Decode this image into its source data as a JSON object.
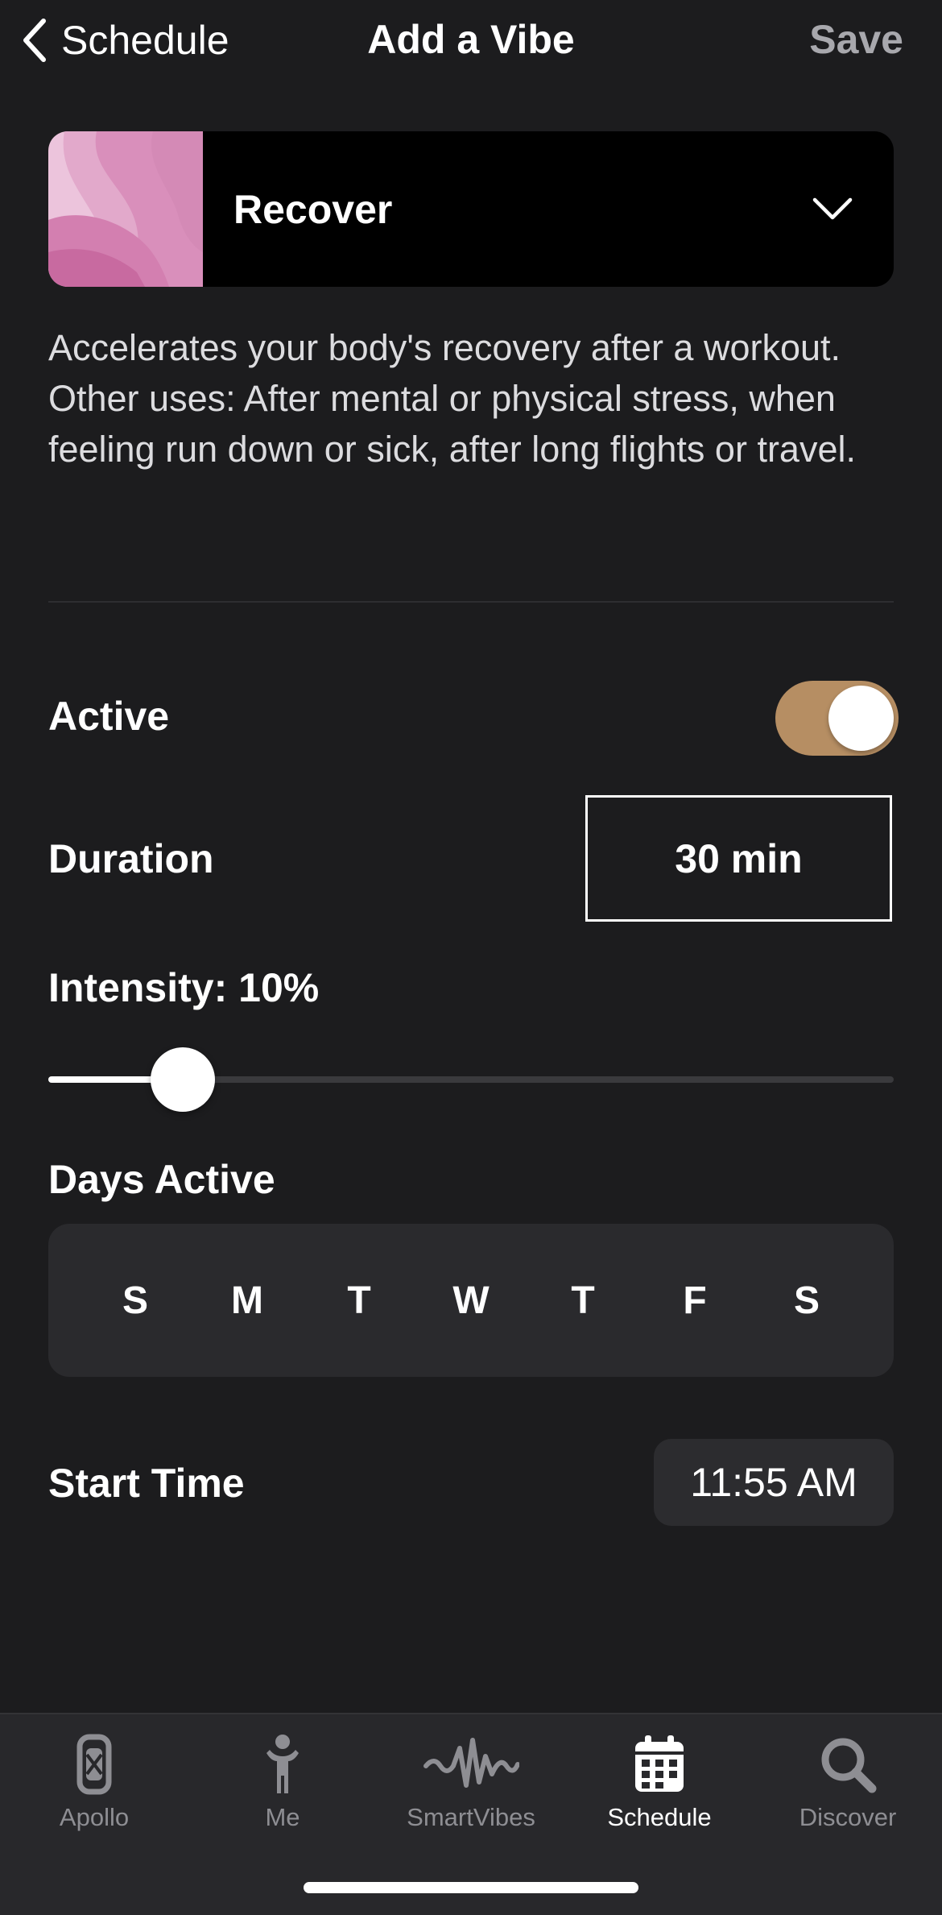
{
  "nav": {
    "back_label": "Schedule",
    "title": "Add a Vibe",
    "save_label": "Save"
  },
  "vibe": {
    "name": "Recover",
    "description": "Accelerates your body's recovery after a workout. Other uses: After mental or physical stress, when feeling run down or sick, after long flights or travel."
  },
  "settings": {
    "active_label": "Active",
    "active_on": true,
    "duration_label": "Duration",
    "duration_value": "30 min",
    "intensity_label": "Intensity: 10%",
    "intensity_value": 0.1,
    "days_label": "Days Active",
    "days": [
      "S",
      "M",
      "T",
      "W",
      "T",
      "F",
      "S"
    ],
    "start_time_label": "Start Time",
    "start_time_value": "11:55 AM"
  },
  "tabs": [
    {
      "label": "Apollo",
      "icon": "apollo-device-icon",
      "active": false
    },
    {
      "label": "Me",
      "icon": "person-icon",
      "active": false
    },
    {
      "label": "SmartVibes",
      "icon": "waveform-icon",
      "active": false
    },
    {
      "label": "Schedule",
      "icon": "calendar-icon",
      "active": true
    },
    {
      "label": "Discover",
      "icon": "search-icon",
      "active": false
    }
  ],
  "colors": {
    "background": "#1c1c1e",
    "toggle_on": "#b68e63",
    "tab_inactive": "#8e8e93",
    "tab_active": "#ffffff"
  }
}
